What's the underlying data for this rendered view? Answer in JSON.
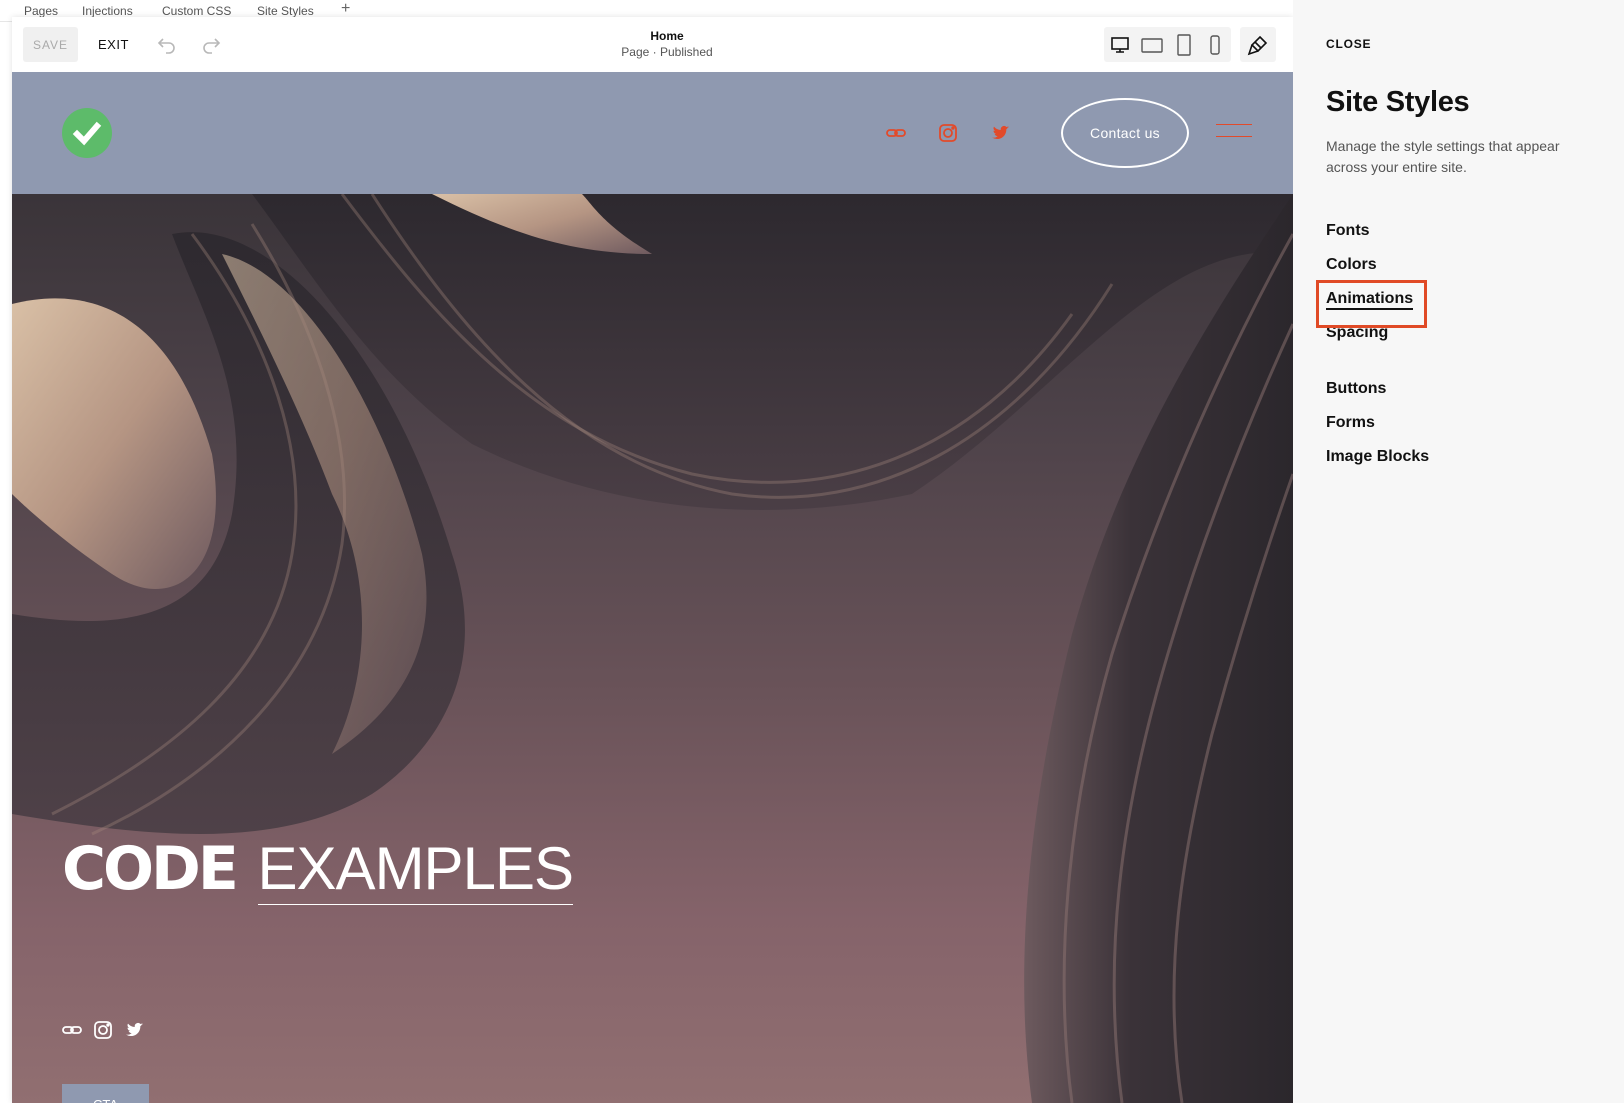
{
  "devtabs": {
    "items": [
      "Pages",
      "Injections",
      "Custom CSS",
      "Site Styles"
    ],
    "add_label": "+"
  },
  "toolbar": {
    "save_label": "SAVE",
    "exit_label": "EXIT",
    "page_title": "Home",
    "page_status": "Page · Published",
    "undo_icon": "undo-icon",
    "redo_icon": "redo-icon",
    "devices": [
      "desktop-icon",
      "tablet-landscape-icon",
      "tablet-portrait-icon",
      "mobile-icon"
    ],
    "style_icon": "paintbrush-icon"
  },
  "site": {
    "header_bg": "#8f99b0",
    "accent": "#e24a2a",
    "logo_color": "#5dbb6a",
    "contact_label": "Contact us",
    "hero_title_bold": "CODE",
    "hero_title_light": "EXAMPLES",
    "cta_label": "CTA"
  },
  "panel": {
    "close_label": "CLOSE",
    "title": "Site Styles",
    "description": "Manage the style settings that appear across your entire site.",
    "group1": [
      "Fonts",
      "Colors",
      "Animations",
      "Spacing"
    ],
    "group2": [
      "Buttons",
      "Forms",
      "Image Blocks"
    ],
    "active_item": "Animations",
    "highlight_color": "#e04a26"
  }
}
